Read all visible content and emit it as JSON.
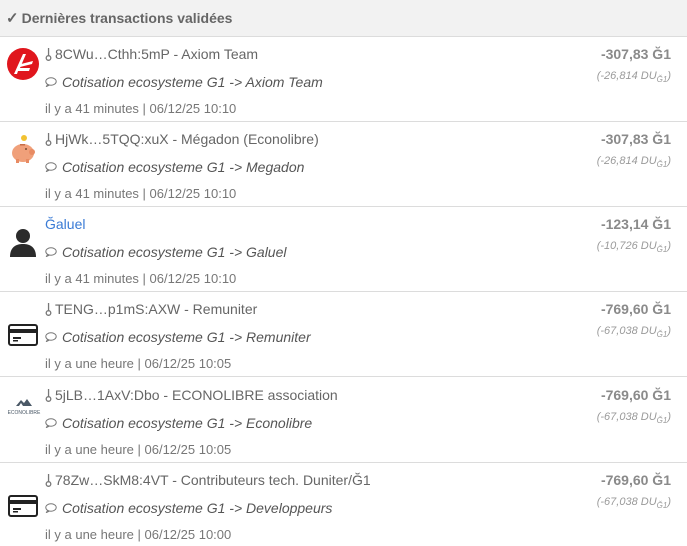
{
  "header": {
    "title": "Dernières transactions validées"
  },
  "transactions": [
    {
      "avatar": "axiom-logo-icon",
      "issuer": "8CWu…Cthh:5mP - Axiom Team",
      "comment": "Cotisation ecosysteme G1 -> Axiom Team",
      "time": "il y a 41 minutes | 06/12/25 10:10",
      "amount": "-307,83 Ğ1",
      "amount_du": "(-26,814 DU",
      "du_unit": "Ğ1",
      "du_close": ")"
    },
    {
      "avatar": "piggy-bank-icon",
      "issuer": "HjWk…5TQQ:xuX - Mégadon (Econolibre)",
      "comment": "Cotisation ecosysteme G1 -> Megadon",
      "time": "il y a 41 minutes | 06/12/25 10:10",
      "amount": "-307,83 Ğ1",
      "amount_du": "(-26,814 DU",
      "du_unit": "Ğ1",
      "du_close": ")"
    },
    {
      "avatar": "user-silhouette-icon",
      "issuer": "Ğaluel",
      "comment": "Cotisation ecosysteme G1 -> Galuel",
      "time": "il y a 41 minutes | 06/12/25 10:10",
      "amount": "-123,14 Ğ1",
      "amount_du": "(-10,726 DU",
      "du_unit": "Ğ1",
      "du_close": ")"
    },
    {
      "avatar": "credit-card-icon",
      "issuer": "TENG…p1mS:AXW - Remuniter",
      "comment": "Cotisation ecosysteme G1 -> Remuniter",
      "time": "il y a une heure | 06/12/25 10:05",
      "amount": "-769,60 Ğ1",
      "amount_du": "(-67,038 DU",
      "du_unit": "Ğ1",
      "du_close": ")"
    },
    {
      "avatar": "econolibre-logo-icon",
      "avatar_text": "ECONOLIBRE",
      "issuer": "5jLB…1AxV:Dbo - ECONOLIBRE association",
      "comment": "Cotisation ecosysteme G1 -> Econolibre",
      "time": "il y a une heure | 06/12/25 10:05",
      "amount": "-769,60 Ğ1",
      "amount_du": "(-67,038 DU",
      "du_unit": "Ğ1",
      "du_close": ")"
    },
    {
      "avatar": "credit-card-icon",
      "issuer": "78Zw…SkM8:4VT - Contributeurs tech. Duniter/Ğ1",
      "comment": "Cotisation ecosysteme G1 -> Developpeurs",
      "time": "il y a une heure | 06/12/25 10:00",
      "amount": "-769,60 Ğ1",
      "amount_du": "(-67,038 DU",
      "du_unit": "Ğ1",
      "du_close": ")"
    }
  ]
}
